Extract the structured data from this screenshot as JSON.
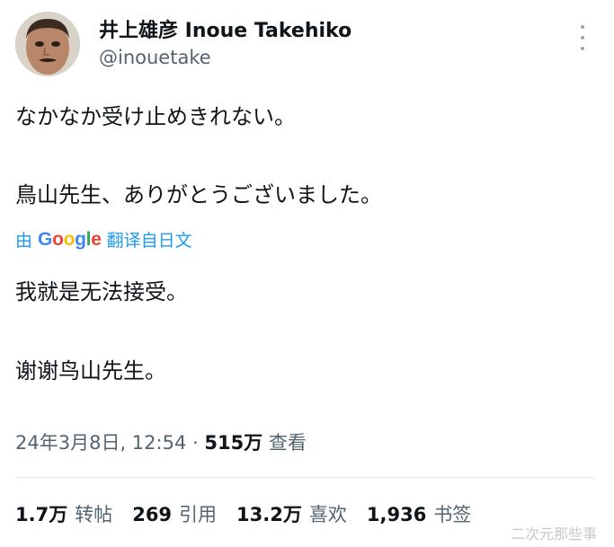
{
  "author": {
    "display_name": "井上雄彦 Inoue Takehiko",
    "handle": "@inouetake"
  },
  "tweet": {
    "lines": [
      "なかなか受け止めきれない。",
      "鳥山先生、ありがとうございました。"
    ]
  },
  "translation": {
    "prefix": "由",
    "brand": "Google",
    "suffix": "翻译自日文",
    "lines": [
      "我就是无法接受。",
      "谢谢鸟山先生。"
    ]
  },
  "meta": {
    "timestamp": "24年3月8日, 12:54",
    "separator": " · ",
    "views_count": "515万",
    "views_label": " 查看"
  },
  "stats": [
    {
      "num": "1.7万",
      "label": "转帖"
    },
    {
      "num": "269",
      "label": "引用"
    },
    {
      "num": "13.2万",
      "label": "喜欢"
    },
    {
      "num": "1,936",
      "label": "书签"
    }
  ],
  "watermark": "二次元那些事",
  "icons": {
    "more": "more-vertical-icon"
  },
  "colors": {
    "text": "#0f1419",
    "secondary": "#536471",
    "link": "#1d9bf0"
  }
}
